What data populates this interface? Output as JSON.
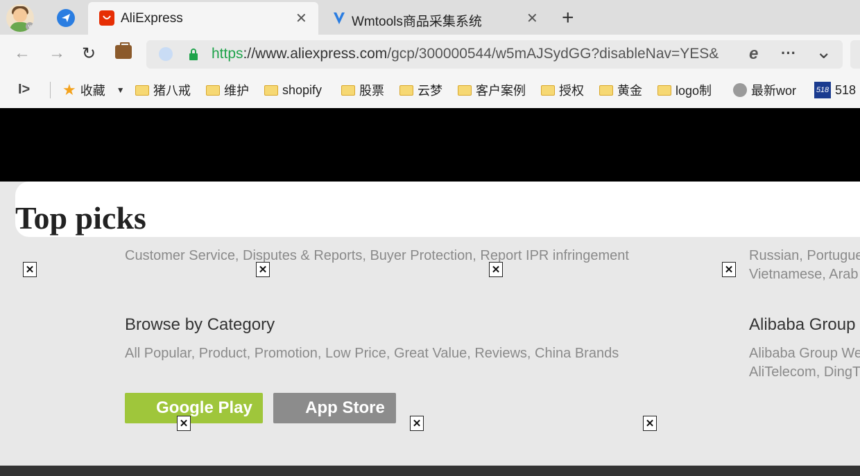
{
  "tabs": [
    {
      "title": "AliExpress",
      "close": "✕"
    },
    {
      "title": "Wmtools商品采集系统",
      "close": "✕"
    }
  ],
  "new_tab": "+",
  "url": {
    "secure": "https",
    "host": "://www.aliexpress.com",
    "path": "/gcp/300000544/w5mAJSydGG?disableNav=YES&"
  },
  "bookmarks": {
    "collapse_icon": "I>",
    "favorites": "收藏",
    "items": [
      "猪八戒",
      "维护",
      "shopify",
      "股票",
      "云梦",
      "客户案例",
      "授权",
      "黄金",
      "logo制",
      "最新wor",
      "518"
    ],
    "badge_518": "518"
  },
  "page": {
    "heading": "Top picks",
    "help_links": "Customer Service, Disputes & Reports, Buyer Protection, Report IPR infringement",
    "languages_line1": "Russian, Portugue",
    "languages_line2": "Vietnamese, Arab",
    "browse_title": "Browse by Category",
    "browse_links": "All Popular, Product, Promotion, Low Price, Great Value, Reviews, China Brands",
    "alibaba_title": "Alibaba Group",
    "alibaba_line1": "Alibaba Group We",
    "alibaba_line2": "AliTelecom, DingT",
    "google_play": "Google Play",
    "app_store": "App Store",
    "broken_glyph": "✕"
  },
  "colors": {
    "google_play": "#9fc63b",
    "app_store": "#8c8c8c",
    "url_secure": "#1fa34b",
    "tab_favicon_ali": "#e62e04",
    "tab_favicon_wm": "#2a7de1"
  },
  "icons": {
    "back": "←",
    "forward": "→",
    "reload": "↻",
    "briefcase": "💼",
    "lock": "🔒",
    "ie": "e",
    "more": "···",
    "dropdown": "⌄",
    "star": "★"
  }
}
